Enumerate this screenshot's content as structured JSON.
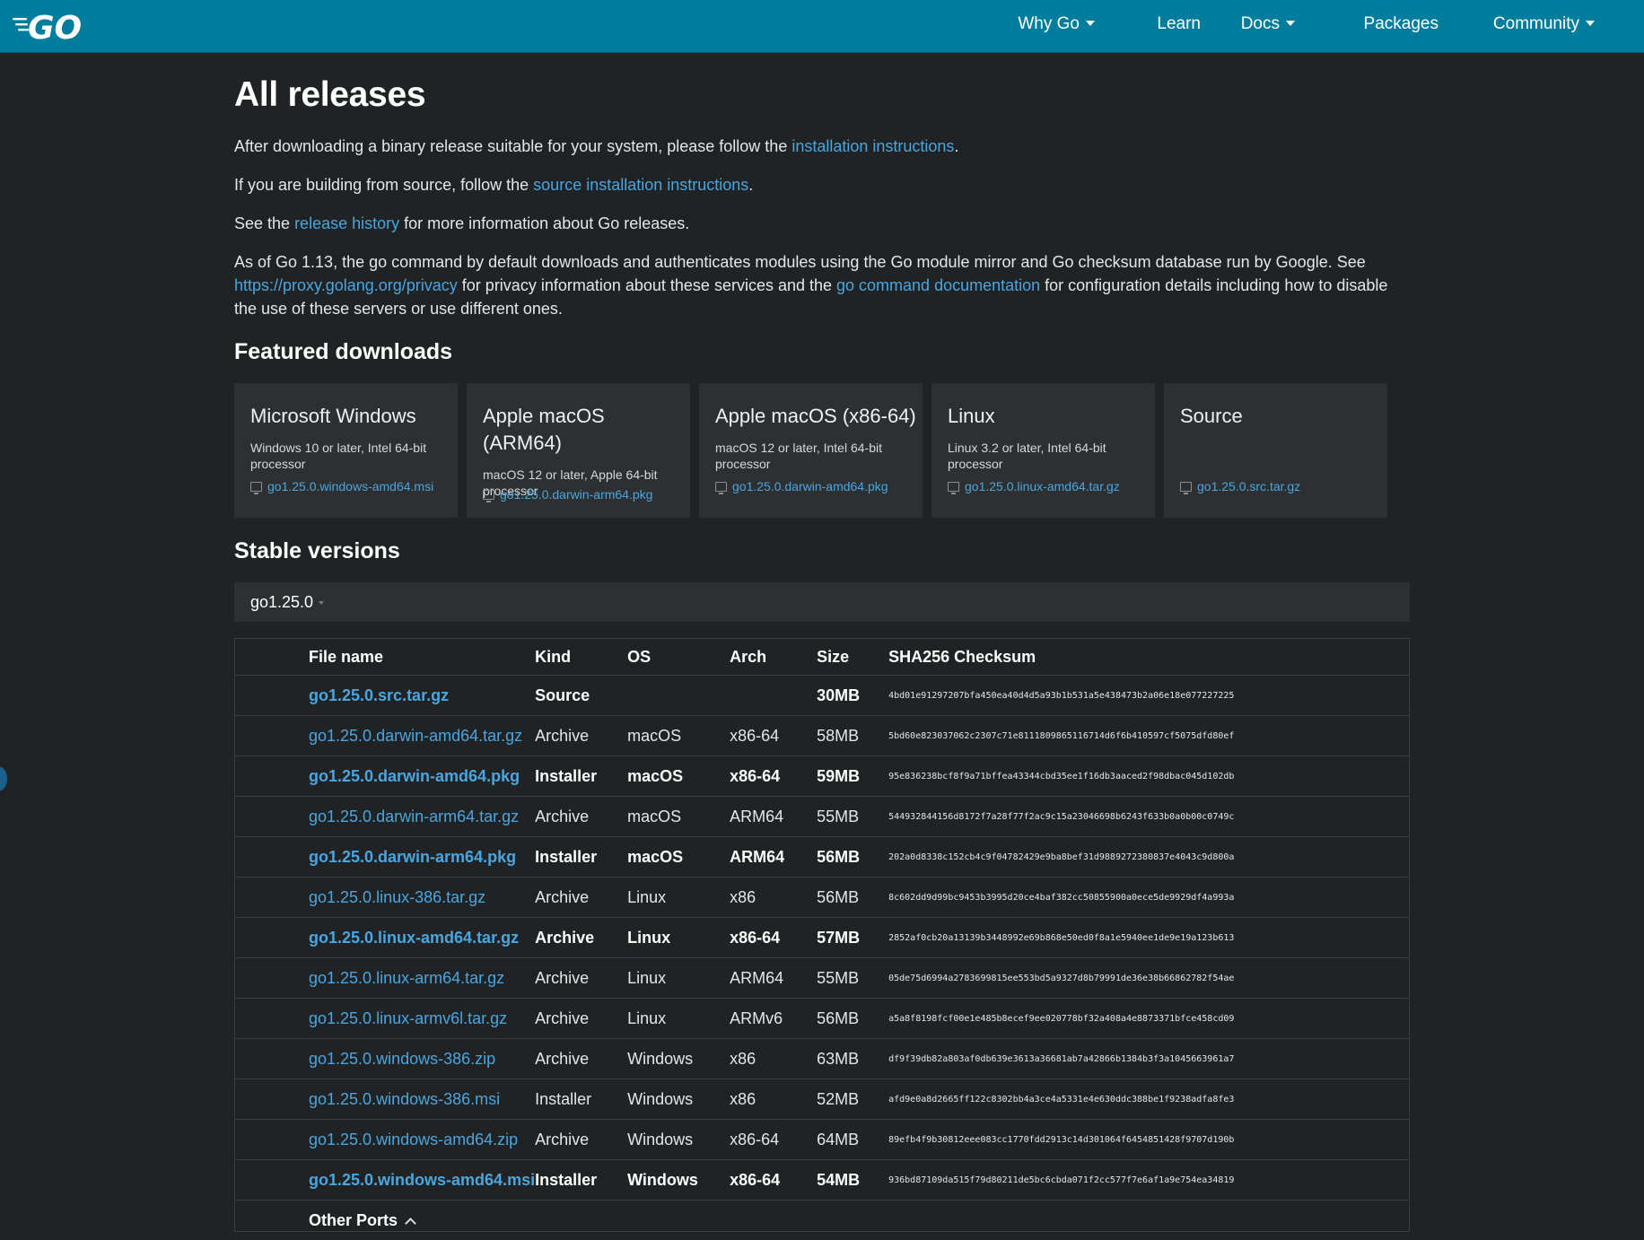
{
  "header": {
    "logo_text": "GO",
    "nav": [
      {
        "label": "Why Go",
        "dropdown": true
      },
      {
        "label": "Learn",
        "dropdown": false
      },
      {
        "label": "Docs",
        "dropdown": true
      },
      {
        "label": "Packages",
        "dropdown": false
      },
      {
        "label": "Community",
        "dropdown": true
      }
    ]
  },
  "page": {
    "title": "All releases",
    "p1": {
      "before": "After downloading a binary release suitable for your system, please follow the ",
      "link": "installation instructions",
      "after": "."
    },
    "p2": {
      "before": "If you are building from source, follow the ",
      "link": "source installation instructions",
      "after": "."
    },
    "p3": {
      "before": "See the ",
      "link": "release history",
      "after": " for more information about Go releases."
    },
    "p4": {
      "text1": "As of Go 1.13, the go command by default downloads and authenticates modules using the Go module mirror and Go checksum database run by Google. See ",
      "link1": "https://proxy.golang.org/privacy",
      "text2": " for privacy information about these services and the ",
      "link2": "go command documentation",
      "text3": " for configuration details including how to disable the use of these servers or use different ones."
    }
  },
  "featured": {
    "heading": "Featured downloads",
    "cards": [
      {
        "title": "Microsoft Windows",
        "desc": "Windows 10 or later, Intel 64-bit processor",
        "file": "go1.25.0.windows-amd64.msi"
      },
      {
        "title": "Apple macOS (ARM64)",
        "desc": "macOS 12 or later, Apple 64-bit processor",
        "file": "go1.25.0.darwin-arm64.pkg"
      },
      {
        "title": "Apple macOS (x86-64)",
        "desc": "macOS 12 or later, Intel 64-bit processor",
        "file": "go1.25.0.darwin-amd64.pkg"
      },
      {
        "title": "Linux",
        "desc": "Linux 3.2 or later, Intel 64-bit processor",
        "file": "go1.25.0.linux-amd64.tar.gz"
      },
      {
        "title": "Source",
        "desc": "",
        "file": "go1.25.0.src.tar.gz"
      }
    ]
  },
  "stable": {
    "heading": "Stable versions",
    "version": "go1.25.0",
    "columns": [
      "File name",
      "Kind",
      "OS",
      "Arch",
      "Size",
      "SHA256 Checksum"
    ],
    "rows": [
      {
        "file": "go1.25.0.src.tar.gz",
        "kind": "Source",
        "os": "",
        "arch": "",
        "size": "30MB",
        "sha": "4bd01e91297207bfa450ea40d4d5a93b1b531a5e438473b2a06e18e077227225",
        "featured": true
      },
      {
        "file": "go1.25.0.darwin-amd64.tar.gz",
        "kind": "Archive",
        "os": "macOS",
        "arch": "x86-64",
        "size": "58MB",
        "sha": "5bd60e823037062c2307c71e8111809865116714d6f6b410597cf5075dfd80ef",
        "featured": false
      },
      {
        "file": "go1.25.0.darwin-amd64.pkg",
        "kind": "Installer",
        "os": "macOS",
        "arch": "x86-64",
        "size": "59MB",
        "sha": "95e836238bcf8f9a71bffea43344cbd35ee1f16db3aaced2f98dbac045d102db",
        "featured": true
      },
      {
        "file": "go1.25.0.darwin-arm64.tar.gz",
        "kind": "Archive",
        "os": "macOS",
        "arch": "ARM64",
        "size": "55MB",
        "sha": "544932844156d8172f7a28f77f2ac9c15a23046698b6243f633b0a0b00c0749c",
        "featured": false
      },
      {
        "file": "go1.25.0.darwin-arm64.pkg",
        "kind": "Installer",
        "os": "macOS",
        "arch": "ARM64",
        "size": "56MB",
        "sha": "202a0d8338c152cb4c9f04782429e9ba8bef31d9889272380837e4043c9d800a",
        "featured": true
      },
      {
        "file": "go1.25.0.linux-386.tar.gz",
        "kind": "Archive",
        "os": "Linux",
        "arch": "x86",
        "size": "56MB",
        "sha": "8c602dd9d99bc9453b3995d20ce4baf382cc50855900a0ece5de9929df4a993a",
        "featured": false
      },
      {
        "file": "go1.25.0.linux-amd64.tar.gz",
        "kind": "Archive",
        "os": "Linux",
        "arch": "x86-64",
        "size": "57MB",
        "sha": "2852af0cb20a13139b3448992e69b868e50ed0f8a1e5940ee1de9e19a123b613",
        "featured": true
      },
      {
        "file": "go1.25.0.linux-arm64.tar.gz",
        "kind": "Archive",
        "os": "Linux",
        "arch": "ARM64",
        "size": "55MB",
        "sha": "05de75d6994a2783699815ee553bd5a9327d8b79991de36e38b66862782f54ae",
        "featured": false
      },
      {
        "file": "go1.25.0.linux-armv6l.tar.gz",
        "kind": "Archive",
        "os": "Linux",
        "arch": "ARMv6",
        "size": "56MB",
        "sha": "a5a8f8198fcf00e1e485b8ecef9ee020778bf32a408a4e8873371bfce458cd09",
        "featured": false
      },
      {
        "file": "go1.25.0.windows-386.zip",
        "kind": "Archive",
        "os": "Windows",
        "arch": "x86",
        "size": "63MB",
        "sha": "df9f39db82a803af0db639e3613a36681ab7a42866b1384b3f3a1045663961a7",
        "featured": false
      },
      {
        "file": "go1.25.0.windows-386.msi",
        "kind": "Installer",
        "os": "Windows",
        "arch": "x86",
        "size": "52MB",
        "sha": "afd9e0a8d2665ff122c8302bb4a3ce4a5331e4e630ddc388be1f9238adfa8fe3",
        "featured": false
      },
      {
        "file": "go1.25.0.windows-amd64.zip",
        "kind": "Archive",
        "os": "Windows",
        "arch": "x86-64",
        "size": "64MB",
        "sha": "89efb4f9b30812eee083cc1770fdd2913c14d301064f6454851428f9707d190b",
        "featured": false
      },
      {
        "file": "go1.25.0.windows-amd64.msi",
        "kind": "Installer",
        "os": "Windows",
        "arch": "x86-64",
        "size": "54MB",
        "sha": "936bd87109da515f79d80211de5bc6cbda071f2cc577f7e6af1a9e754ea34819",
        "featured": true
      }
    ],
    "other_ports": "Other Ports"
  },
  "colors": {
    "header": "#007d9c",
    "background": "#202224",
    "link": "#4aa6e0",
    "card": "#2d2f31"
  }
}
